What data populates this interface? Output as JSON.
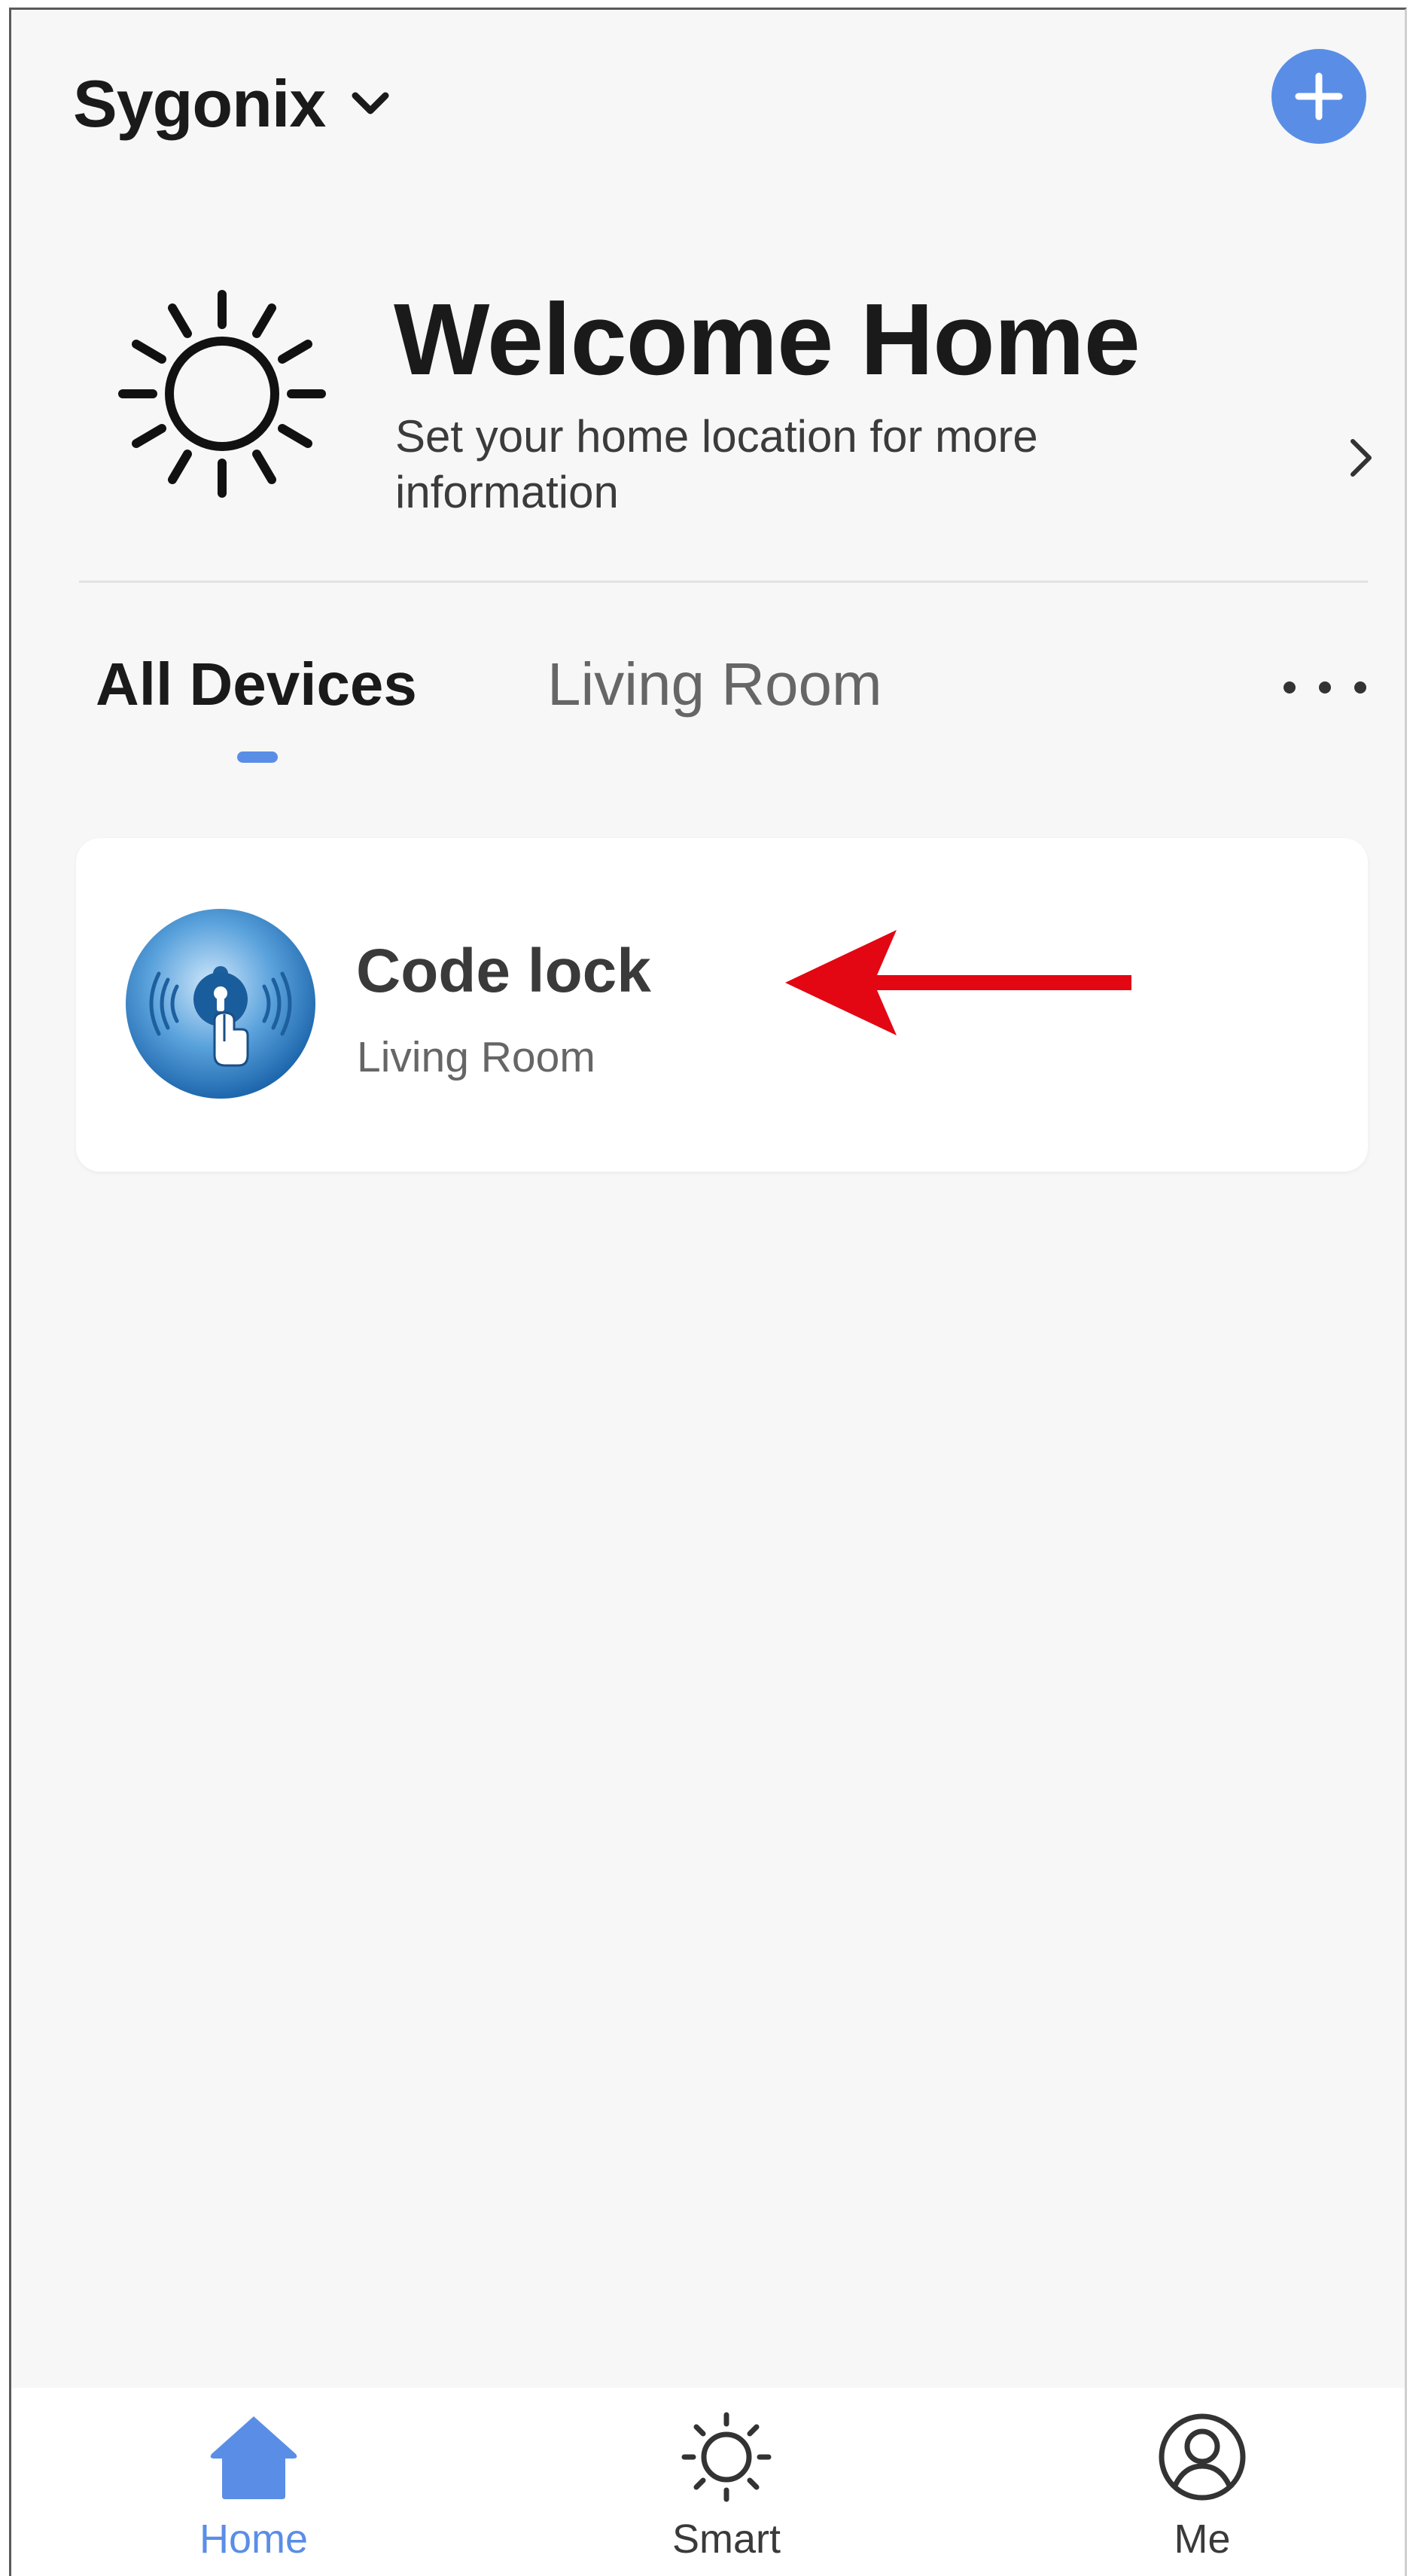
{
  "header": {
    "home_name": "Sygonix",
    "home_switcher_icon": "chevron-down-icon",
    "add_icon": "plus-icon"
  },
  "welcome": {
    "title": "Welcome Home",
    "subtitle": "Set your home location for more information",
    "weather_icon": "sun-icon",
    "chevron_icon": "chevron-right-icon"
  },
  "tabs": [
    {
      "label": "All Devices",
      "active": true
    },
    {
      "label": "Living Room",
      "active": false
    }
  ],
  "more_icon": "more-dots-icon",
  "devices": [
    {
      "name": "Code lock",
      "room": "Living Room",
      "icon": "code-lock-icon"
    }
  ],
  "annotation": {
    "icon": "red-arrow-icon",
    "color": "#e30613"
  },
  "bottom_nav": [
    {
      "label": "Home",
      "icon": "home-icon",
      "active": true
    },
    {
      "label": "Smart",
      "icon": "sun-outline-icon",
      "active": false
    },
    {
      "label": "Me",
      "icon": "user-circle-icon",
      "active": false
    }
  ],
  "colors": {
    "accent": "#5a8ee6",
    "background": "#f7f7f7",
    "card": "#ffffff",
    "text_primary": "#1a1a1a",
    "text_secondary": "#666666"
  }
}
